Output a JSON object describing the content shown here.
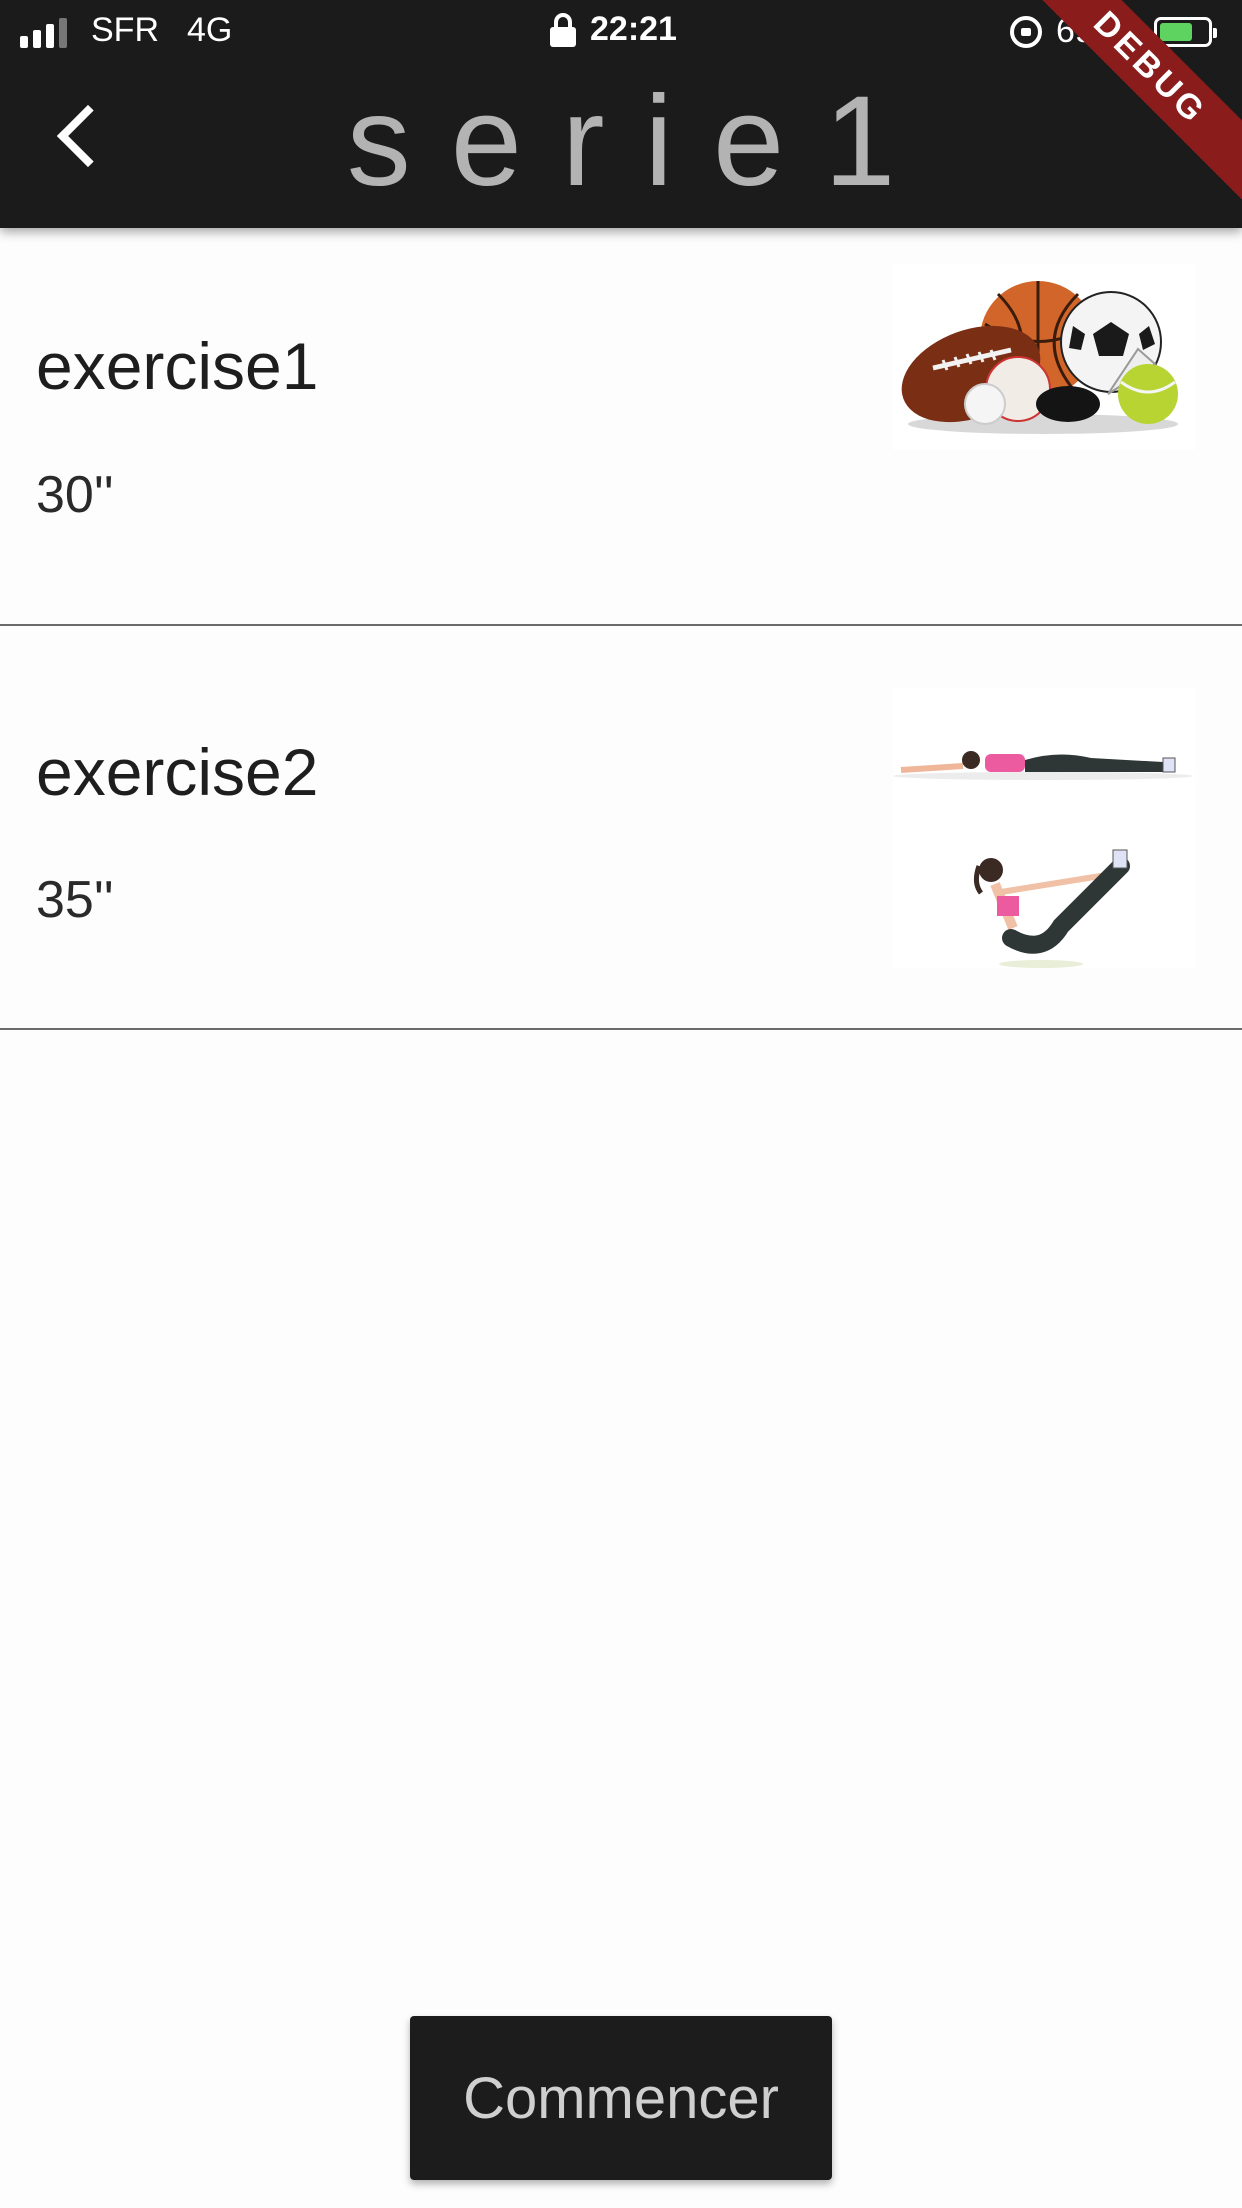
{
  "status_bar": {
    "carrier": "SFR",
    "network": "4G",
    "time": "22:21",
    "battery_percent": "69 %",
    "battery_level": 0.69
  },
  "app_bar": {
    "title": "serie1",
    "debug_banner": "DEBUG",
    "back_icon": "chevron-left-icon"
  },
  "exercises": [
    {
      "name": "exercise1",
      "duration": "30''",
      "image": "sports-balls-image"
    },
    {
      "name": "exercise2",
      "duration": "35''",
      "image": "abdominal-exercise-image"
    }
  ],
  "start_button": {
    "label": "Commencer"
  },
  "colors": {
    "header_bg": "#1b1b1b",
    "title": "#b3b3b3",
    "debug_banner": "#8a1c1c",
    "battery_fill": "#5fd35f",
    "button_bg": "#1c1c1c"
  }
}
